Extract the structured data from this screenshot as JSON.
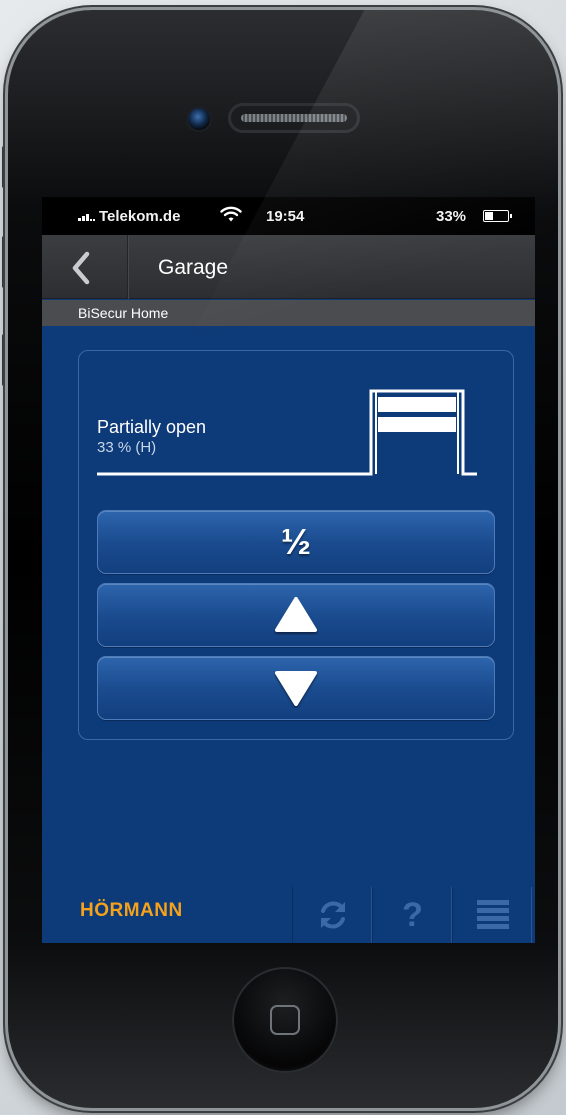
{
  "status_bar": {
    "carrier": "Telekom.de",
    "time": "19:54",
    "battery_percent": "33%",
    "signal_icon": "signal-bars-icon",
    "wifi_icon": "wifi-icon",
    "battery_icon": "battery-icon"
  },
  "nav_bar": {
    "back_icon": "chevron-left-icon",
    "title": "Garage"
  },
  "sub_bar": {
    "label": "BiSecur Home"
  },
  "door": {
    "state": "Partially open",
    "percent_text": "33 % (H)",
    "open_fraction": 0.33,
    "diagram_icon": "garage-door-icon"
  },
  "controls": {
    "half_label": "½",
    "up_icon": "triangle-up-icon",
    "down_icon": "triangle-down-icon"
  },
  "footer": {
    "brand": "HÖRMANN",
    "refresh_icon": "refresh-icon",
    "help_label": "?",
    "menu_icon": "menu-lines-icon"
  },
  "colors": {
    "screen_background": "#0d3a78",
    "button_blue": "#1b4c90",
    "brand_orange": "#f4a11c",
    "nav_bar": "#34363a",
    "footer_icon": "#3b69a8"
  }
}
